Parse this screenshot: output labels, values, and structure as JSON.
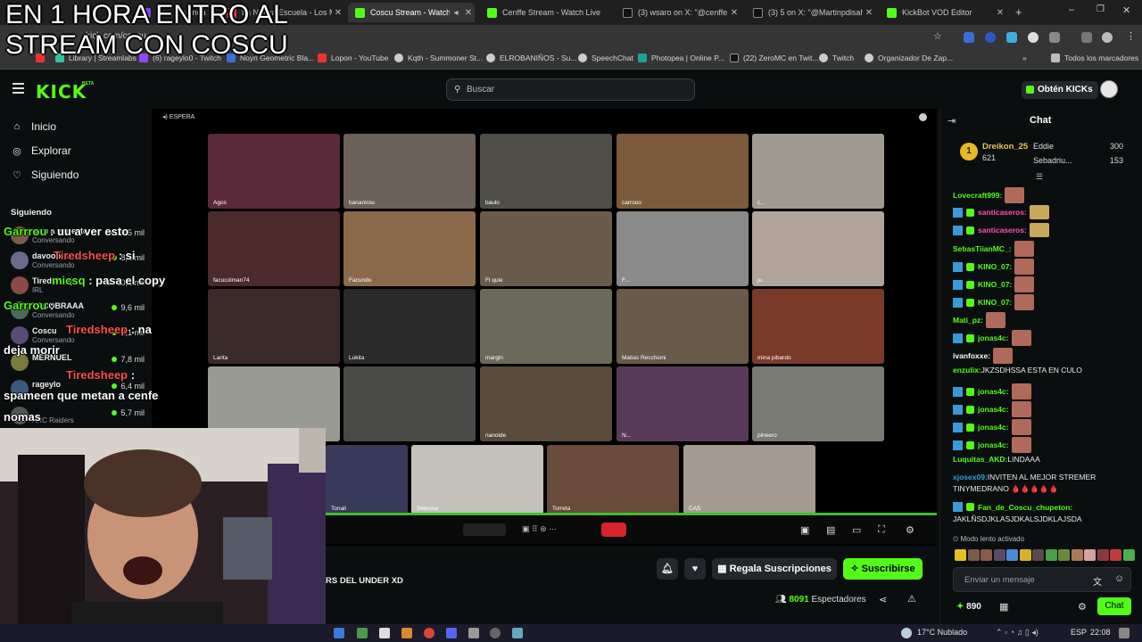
{
  "overlay": {
    "title_line1": "EN 1 HORA ENTRO AL",
    "title_line2": "STREAM CON COSCU",
    "chat_lines": [
      {
        "user": "Garrrou",
        "text": " : uu a ver esto"
      },
      {
        "user": "Tiredsheep",
        "text": " : si"
      },
      {
        "user": "micsq",
        "text": " : pasa el copy"
      },
      {
        "user": "Garrrou",
        "text": " :"
      },
      {
        "user": "Tiredsheep",
        "text": " : na"
      },
      {
        "extra": "deja morir"
      },
      {
        "user": "Tiredsheep",
        "text": " :"
      },
      {
        "extra": "spameen que metan a cenfe"
      },
      {
        "extra": "nomas"
      }
    ]
  },
  "browser": {
    "tabs": [
      {
        "label": "Ba... Leyenda",
        "active": false
      },
      {
        "label": "La Nueva Escuela - Los M",
        "active": false
      },
      {
        "label": "Coscu Stream - Watch Li...",
        "active": true
      },
      {
        "label": "Cenffe Stream - Watch Live",
        "active": false
      },
      {
        "label": "(3) wsaro on X: \"@cenffe144",
        "active": false
      },
      {
        "label": "(3) 5 on X: \"@Martinpdisalvo",
        "active": false
      },
      {
        "label": "KickBot VOD Editor",
        "active": false
      }
    ],
    "address": "kick.com/coscu",
    "bookmarks": [
      "Library | Streamlabs",
      "(6) rageylo0 - Twitch",
      "Noyn Geometric Bla...",
      "Lopon - YouTube",
      "Kqth - Summoner St...",
      "ELROBANIÑOS - Su...",
      "SpeechChat",
      "Photopea | Online P...",
      "(22) ZeroMC en Twit...",
      "Twitch",
      "Organizador De Zap..."
    ],
    "all_bookmarks": "Todos los marcadores"
  },
  "kick": {
    "logo": "KICK",
    "logo_beta": "BETA",
    "search_placeholder": "Buscar",
    "get_kicks": "Obtén KICKs",
    "nav": [
      {
        "label": "Inicio",
        "icon": "home-icon"
      },
      {
        "label": "Explorar",
        "icon": "compass-icon"
      },
      {
        "label": "Siguiendo",
        "icon": "heart-icon"
      }
    ],
    "following_header": "Siguiendo",
    "following": [
      {
        "name": "uwu a ver esto",
        "sub": "Conversando",
        "viewers": "10,5 mil"
      },
      {
        "name": "davoo xeneize",
        "sub": "Conversando",
        "viewers": "8,1 mil"
      },
      {
        "name": "Tiredsheep",
        "sub": "IRL",
        "viewers": "10,1 mil"
      },
      {
        "name": "LACOBRAAA",
        "sub": "Conversando",
        "viewers": "9,6 mil"
      },
      {
        "name": "Coscu",
        "sub": "Conversando",
        "viewers": "8,1 mil"
      },
      {
        "name": "MERNUEL",
        "sub": "",
        "viewers": "7,8 mil"
      },
      {
        "name": "rageylo",
        "sub": "",
        "viewers": "6,4 mil"
      },
      {
        "name": "",
        "sub": "ARC Raiders",
        "viewers": "5,7 mil"
      }
    ]
  },
  "stream": {
    "status": "ESPERA",
    "participants": [
      "Agos",
      "bananirou",
      "baulo",
      "carrooo",
      "c...",
      "facucolman74",
      "Facundo",
      "Fl quie",
      "F...",
      "ju",
      "Larita",
      "Lukita",
      "margin",
      "Matias Recchioni",
      "mina pibardo",
      "m...",
      "",
      "nanoide",
      "N...",
      "pineero",
      "",
      "Tonali",
      "Silenciar",
      "Torreta",
      "CAS"
    ],
    "stream_title": "RS DEL UNDER XD",
    "gift_subs": "Regala Suscripciones",
    "subscribe": "Suscribirse",
    "viewers_count": "8091",
    "viewers_label": "Espectadores"
  },
  "chat": {
    "header": "Chat",
    "leaderboard": [
      {
        "name": "Dreikon_25",
        "value": "621",
        "rank": "1"
      },
      {
        "name": "Eddie",
        "value": "300"
      },
      {
        "name": "Sebadriu...",
        "value": "153"
      }
    ],
    "messages": [
      {
        "user": "Lovecraft999:",
        "text": "",
        "color": "#53fc18",
        "emote": true
      },
      {
        "user": "santicaseros:",
        "text": "",
        "color": "#ff4fb8",
        "emote": true,
        "badges": true
      },
      {
        "user": "santicaseros:",
        "text": "",
        "color": "#ff4fb8",
        "emote": true,
        "badges": true
      },
      {
        "user": "SebasTiianMC_:",
        "text": "",
        "color": "#53fc18",
        "emote": true
      },
      {
        "user": "KINO_07:",
        "text": "",
        "color": "#53fc18",
        "emote": true,
        "badges": true
      },
      {
        "user": "KINO_07:",
        "text": "",
        "color": "#53fc18",
        "emote": true,
        "badges": true
      },
      {
        "user": "KINO_07:",
        "text": "",
        "color": "#53fc18",
        "emote": true,
        "badges": true
      },
      {
        "user": "Mati_pz:",
        "text": "",
        "color": "#53fc18",
        "emote": true
      },
      {
        "user": "jonas4c:",
        "text": "",
        "color": "#53fc18",
        "emote": true,
        "badges": true
      },
      {
        "user": "ivanfoxxe:",
        "text": "",
        "color": "#ffffff",
        "emote": true
      },
      {
        "user": "enzulix:",
        "text": " JKZSDHSSA ESTA EN CULO",
        "color": "#53fc18"
      },
      {
        "user": "jonas4c:",
        "text": "",
        "color": "#53fc18",
        "emote": true,
        "badges": true
      },
      {
        "user": "jonas4c:",
        "text": "",
        "color": "#53fc18",
        "emote": true,
        "badges": true
      },
      {
        "user": "jonas4c:",
        "text": "",
        "color": "#53fc18",
        "emote": true,
        "badges": true
      },
      {
        "user": "jonas4c:",
        "text": "",
        "color": "#53fc18",
        "emote": true,
        "badges": true
      },
      {
        "user": "Luquitas_AKD:",
        "text": " LINDAAA",
        "color": "#53fc18"
      },
      {
        "user": "xjosex09:",
        "text": " INVITEN AL MEJOR STREMER",
        "color": "#3a9ad9"
      },
      {
        "user": "",
        "text": "TINYMEDRANO 🩸🩸🩸🩸🩸",
        "color": "#ffffff"
      },
      {
        "user": "Fan_de_Coscu_chupeton:",
        "text": "",
        "color": "#53fc18",
        "badges": true
      },
      {
        "user": "",
        "text": "JAKLÑSDJKLASJDKALSJDKLAJSDA",
        "color": "#ffffff"
      }
    ],
    "slow_mode": "Modo lento activado",
    "input_placeholder": "Enviar un mensaje",
    "points": "890",
    "send_button": "Chat"
  },
  "taskbar": {
    "weather": "17°C  Nublado",
    "lang": "ESP",
    "time": "22:08"
  }
}
